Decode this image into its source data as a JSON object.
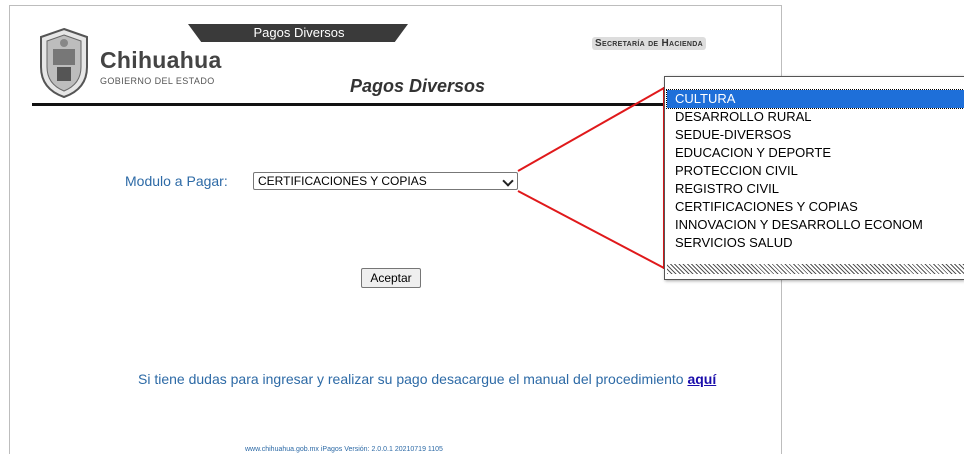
{
  "header": {
    "tab_title": "Pagos Diversos",
    "brand_name": "Chihuahua",
    "brand_subtitle": "GOBIERNO DEL ESTADO",
    "secretaria": "Secretaría de Hacienda",
    "page_heading": "Pagos Diversos"
  },
  "form": {
    "modulo_label": "Modulo a Pagar:",
    "modulo_selected": "CERTIFICACIONES Y COPIAS",
    "accept_label": "Aceptar"
  },
  "dropdown": {
    "options": [
      "CULTURA",
      "DESARROLLO RURAL",
      "SEDUE-DIVERSOS",
      "EDUCACION Y DEPORTE",
      "PROTECCION CIVIL",
      "REGISTRO CIVIL",
      "CERTIFICACIONES Y COPIAS",
      "INNOVACION Y DESARROLLO ECONOM",
      "SERVICIOS SALUD"
    ],
    "highlighted": "CULTURA"
  },
  "manual": {
    "text": "Si tiene dudas para ingresar y realizar su pago desacargue el manual del procedimiento",
    "link_text": "aquí"
  },
  "footer": {
    "text": "www.chihuahua.gob.mx iPagos Versión: 2.0.0.1 20210719 1105"
  },
  "colors": {
    "label_blue": "#2d6aa6",
    "highlight_blue": "#1e6fd9",
    "callout_red": "#e0191b"
  }
}
